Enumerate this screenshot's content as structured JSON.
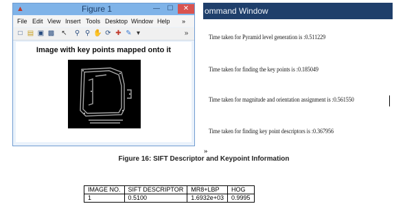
{
  "figure_window": {
    "title": "Figure 1",
    "controls": {
      "minimize": "—",
      "maximize": "☐",
      "close": "✕"
    },
    "menu": [
      "File",
      "Edit",
      "View",
      "Insert",
      "Tools",
      "Desktop",
      "Window",
      "Help"
    ],
    "menu_overflow": "»",
    "plot_title": "Image with key points mapped onto it"
  },
  "command_window": {
    "title": "ommand Window",
    "lines": [
      "Time taken for Pyramid level generation is :0.511229",
      "Time taken for finding the key points is :0.185049",
      "Time taken for magnitude and orientation assignment is :0.561550",
      "Time taken for finding key point descriptors is :0.367956"
    ],
    "prompt": "»"
  },
  "caption": "Figure 16: SIFT Descriptor and Keypoint Information",
  "table": {
    "headers": [
      "IMAGE NO.",
      "SIFT DESCRIPTOR",
      "MR8+LBP",
      "HOG"
    ],
    "rows": [
      [
        "1",
        "0.5100",
        "1.6932e+03",
        "0.9995"
      ]
    ]
  }
}
